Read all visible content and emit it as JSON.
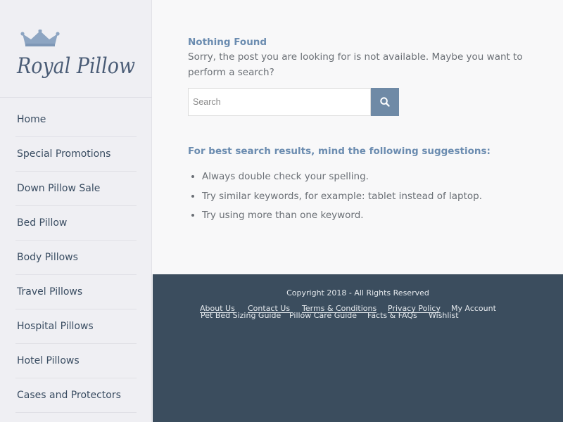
{
  "brand": {
    "logo_text": "Royal Pillow"
  },
  "colors": {
    "accent": "#6b8cb0",
    "search_button": "#6f8aa6",
    "footer_bg": "#3b4d5e",
    "sidebar_bg": "#efeff3"
  },
  "sidebar": {
    "items": [
      {
        "label": "Home"
      },
      {
        "label": "Special Promotions"
      },
      {
        "label": "Down Pillow Sale"
      },
      {
        "label": "Bed Pillow"
      },
      {
        "label": "Body Pillows"
      },
      {
        "label": "Travel Pillows"
      },
      {
        "label": "Hospital Pillows"
      },
      {
        "label": "Hotel Pillows"
      },
      {
        "label": "Cases and Protectors"
      }
    ]
  },
  "main": {
    "heading": "Nothing Found",
    "message": "Sorry, the post you are looking for is not available. Maybe you want to perform a search?",
    "search": {
      "placeholder": "Search",
      "value": "",
      "button_icon": "search-icon"
    },
    "suggestions_title": "For best search results, mind the following suggestions:",
    "suggestions": [
      "Always double check your spelling.",
      "Try similar keywords, for example: tablet instead of laptop.",
      "Try using more than one keyword."
    ]
  },
  "footer": {
    "copyright": "Copyright 2018 - All Rights Reserved",
    "links_row1": [
      "About Us",
      "Contact Us",
      "Terms & Conditions",
      "Privacy Policy",
      "My Account"
    ],
    "links_row2": [
      "Pet Bed Sizing Guide",
      "Pillow Care Guide",
      "Facts & FAQs",
      "Wishlist"
    ]
  }
}
